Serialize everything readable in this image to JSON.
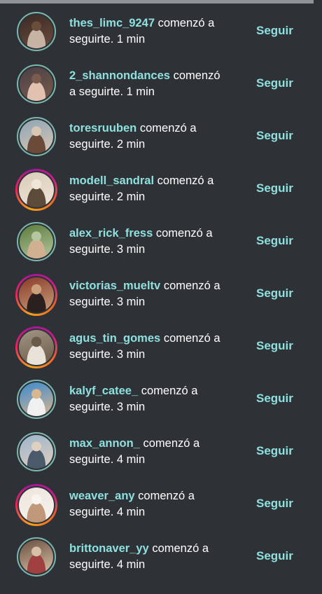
{
  "items": [
    {
      "username": "thes_limc_9247",
      "message": "comenzó a seguirte.",
      "time": "1 min",
      "follow_label": "Seguir",
      "ring": "plain",
      "colors": [
        "#3a2a25",
        "#c7b3a3",
        "#6b4d3c"
      ]
    },
    {
      "username": "2_shannondances",
      "message": "comenzó a seguirte.",
      "time": "1 min",
      "follow_label": "Seguir",
      "ring": "plain",
      "colors": [
        "#4a4046",
        "#e1c2b0",
        "#7a5c4e"
      ]
    },
    {
      "username": "toresruuben",
      "message": "comenzó a seguirte.",
      "time": "2 min",
      "follow_label": "Seguir",
      "ring": "plain",
      "colors": [
        "#8ea5b5",
        "#6b4a3a",
        "#d8c7b4"
      ]
    },
    {
      "username": "modell_sandral",
      "message": "comenzó a seguirte.",
      "time": "2 min",
      "follow_label": "Seguir",
      "ring": "story",
      "colors": [
        "#d9cbb6",
        "#5b4b38",
        "#efe6da"
      ]
    },
    {
      "username": "alex_rick_fress",
      "message": "comenzó a seguirte.",
      "time": "3 min",
      "follow_label": "Seguir",
      "ring": "plain",
      "colors": [
        "#5a7a3a",
        "#d0b090",
        "#b5c7a0"
      ]
    },
    {
      "username": "victorias_mueltv",
      "message": "comenzó a seguirte.",
      "time": "3 min",
      "follow_label": "Seguir",
      "ring": "story",
      "colors": [
        "#8a3a2a",
        "#2a2020",
        "#c9a07a"
      ]
    },
    {
      "username": "agus_tin_gomes",
      "message": "comenzó a seguirte.",
      "time": "3 min",
      "follow_label": "Seguir",
      "ring": "story",
      "colors": [
        "#a29584",
        "#e9e2d8",
        "#6a5a48"
      ]
    },
    {
      "username": "kalyf_catee_",
      "message": "comenzó a seguirte.",
      "time": "3 min",
      "follow_label": "Seguir",
      "ring": "plain",
      "colors": [
        "#3a8ad0",
        "#f0f0f0",
        "#d8b690"
      ]
    },
    {
      "username": "max_annon_",
      "message": "comenzó a seguirte.",
      "time": "4 min",
      "follow_label": "Seguir",
      "ring": "plain",
      "colors": [
        "#9ab4cc",
        "#4a5a6a",
        "#e0d0c0"
      ]
    },
    {
      "username": "weaver_any",
      "message": "comenzó a seguirte.",
      "time": "4 min",
      "follow_label": "Seguir",
      "ring": "story",
      "colors": [
        "#ede4dc",
        "#c0987a",
        "#f8f4f0"
      ]
    },
    {
      "username": "brittonaver_yy",
      "message": "comenzó a seguirte.",
      "time": "4 min",
      "follow_label": "Seguir",
      "ring": "plain",
      "colors": [
        "#6a5040",
        "#a04040",
        "#d8c0a8"
      ]
    }
  ]
}
